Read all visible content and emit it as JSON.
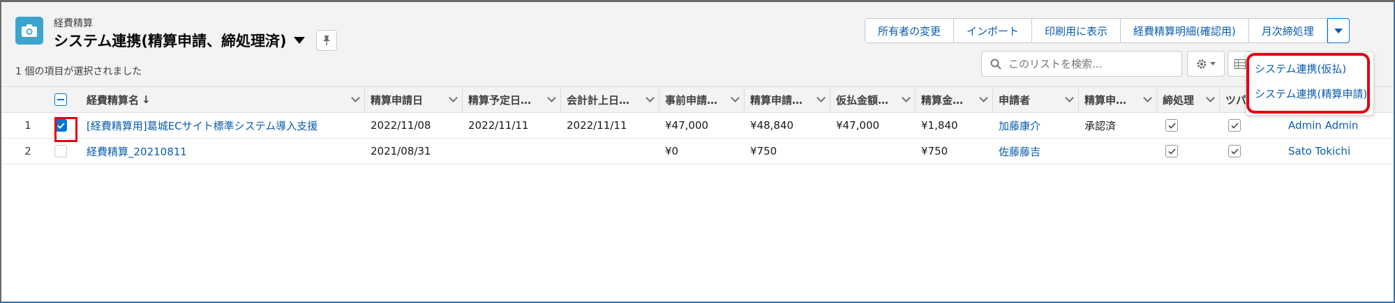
{
  "header": {
    "object_label": "経費精算",
    "list_title": "システム連携(精算申請、締処理済)",
    "selected_text": "1 個の項目が選択されました",
    "buttons": [
      "所有者の変更",
      "インポート",
      "印刷用に表示",
      "経費精算明細(確認用)",
      "月次締処理"
    ],
    "search_placeholder": "このリストを検索...",
    "icons": {
      "object": "camera-icon",
      "pin": "pin-icon",
      "search": "search-icon",
      "settings": "gear-icon",
      "view": "table-view-icon"
    }
  },
  "dropdown": {
    "items": [
      "システム連携(仮払)",
      "システム連携(精算申請)"
    ]
  },
  "table": {
    "columns": [
      "経費精算名",
      "精算申請日",
      "精算予定日…",
      "会計計上日…",
      "事前申請…",
      "精算申請…",
      "仮払金額…",
      "精算金…",
      "申請者",
      "精算申…",
      "締処理",
      "ツパ"
    ],
    "rows": [
      {
        "num": "1",
        "checked": true,
        "name": "[経費精算用]葛城ECサイト標準システム導入支援",
        "apply_date": "2022/11/08",
        "planned_date": "2022/11/11",
        "account_date": "2022/11/11",
        "pre_apply": "¥47,000",
        "settle_apply": "¥48,840",
        "advance": "¥47,000",
        "settle_amount": "¥1,840",
        "applicant": "加藤康介",
        "status": "承認済",
        "closing": true,
        "tsupa": true,
        "owner": "Admin Admin"
      },
      {
        "num": "2",
        "checked": false,
        "name": "経費精算_20210811",
        "apply_date": "2021/08/31",
        "planned_date": "",
        "account_date": "",
        "pre_apply": "¥0",
        "settle_apply": "¥750",
        "advance": "",
        "settle_amount": "¥750",
        "applicant": "佐藤藤吉",
        "status": "",
        "closing": true,
        "tsupa": true,
        "owner": "Sato Tokichi"
      }
    ]
  },
  "colors": {
    "accent": "#0176d3",
    "link": "#0b5cab",
    "highlight": "#e3000f",
    "icon_bg": "#3ba4cf"
  }
}
